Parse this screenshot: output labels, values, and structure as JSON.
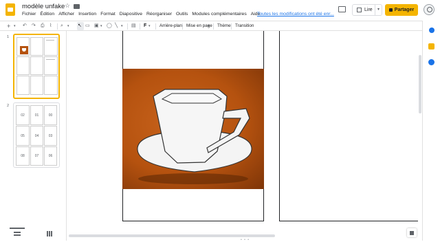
{
  "app": {
    "doc_title": "modèle unfake",
    "menus": [
      "Fichier",
      "Édition",
      "Afficher",
      "Insertion",
      "Format",
      "Diapositive",
      "Réorganiser",
      "Outils",
      "Modules complémentaires",
      "Aide"
    ],
    "save_status": "Toutes les modifications ont été enr...",
    "present_label": "Lire",
    "share_label": "Partager"
  },
  "toolbar": {
    "icons": [
      "add-icon",
      "undo-icon",
      "redo-icon",
      "print-icon",
      "paint-format-icon",
      "zoom-icon",
      "select-icon",
      "textbox-icon",
      "image-icon",
      "shape-icon",
      "line-icon",
      "comment-icon",
      "font-size-icon"
    ],
    "font_size_label": "F",
    "background_label": "Arrière-plan",
    "layout_label": "Mise en page",
    "theme_label": "Thème",
    "transition_label": "Transition"
  },
  "filmstrip": {
    "slides": [
      {
        "number": "1",
        "active": true
      },
      {
        "number": "2",
        "active": false,
        "grid_labels": [
          "02",
          "01",
          "00",
          "05",
          "04",
          "03",
          "08",
          "07",
          "06"
        ]
      }
    ]
  },
  "colors": {
    "accent": "#f4b400",
    "link": "#1a73e8",
    "photo_bg": "#b5520f",
    "icon": "#5f6368"
  }
}
